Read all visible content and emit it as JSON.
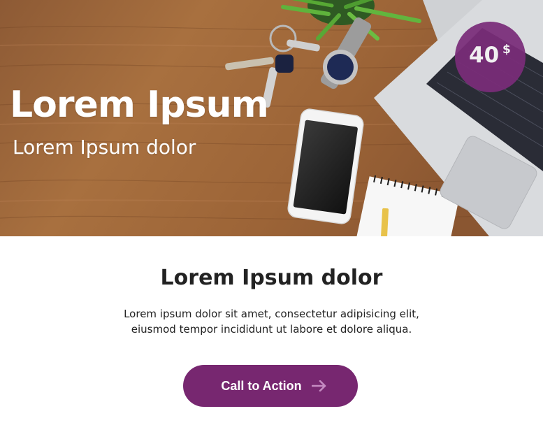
{
  "hero": {
    "title": "Lorem Ipsum",
    "subtitle": "Lorem Ipsum dolor",
    "price": {
      "amount": "40",
      "currency": "$"
    }
  },
  "content": {
    "heading": "Lorem Ipsum dolor",
    "text_line_1": "Lorem ipsum dolor sit amet, consectetur adipisicing elit,",
    "text_line_2": "eiusmod tempor incididunt ut labore et dolore aliqua."
  },
  "cta": {
    "label": "Call to Action",
    "icon": "arrow-right-icon"
  },
  "colors": {
    "accent": "#772770",
    "badge": "#7a2c79",
    "arrow": "#c58bc2",
    "text": "#222222"
  }
}
